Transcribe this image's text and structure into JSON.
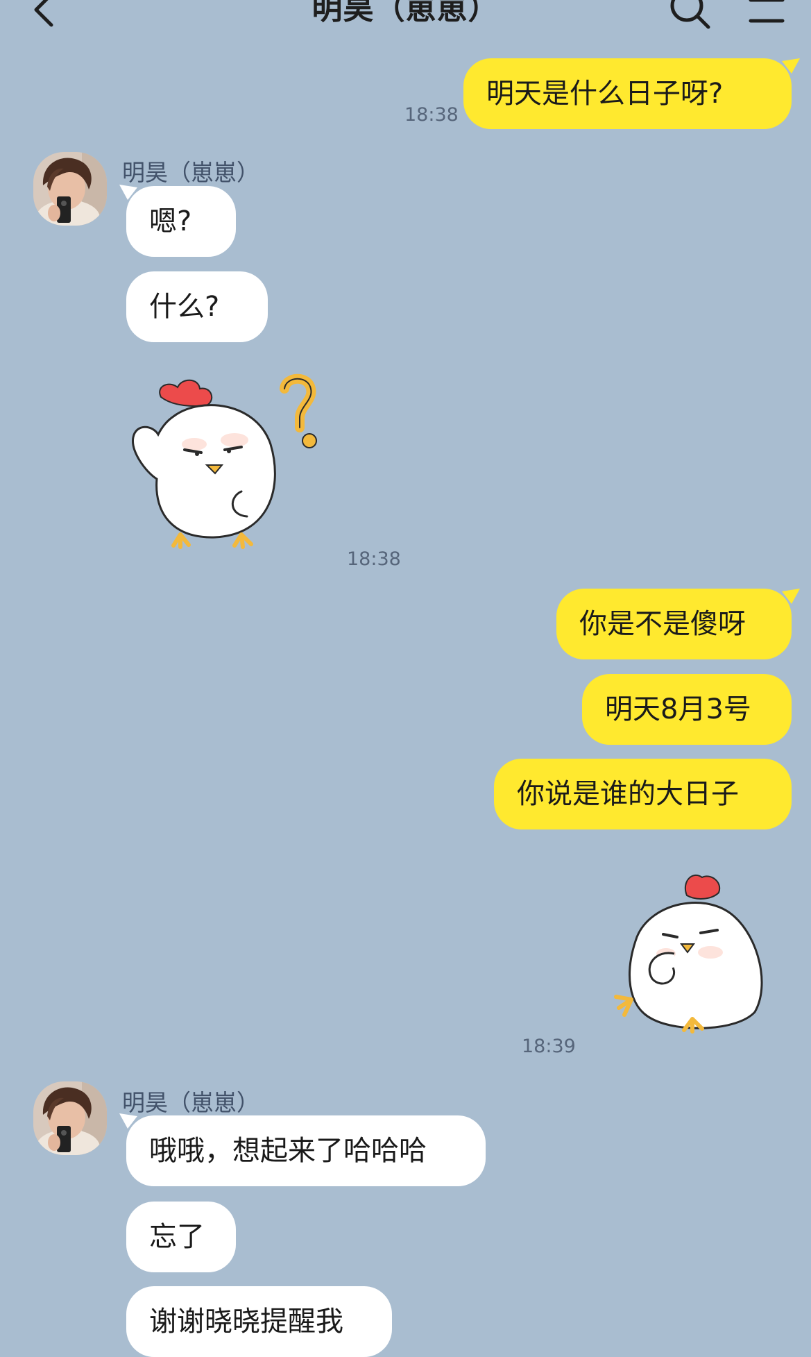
{
  "header": {
    "title": "明昊（崽崽）"
  },
  "messages": {
    "m1": {
      "text": "明天是什么日子呀?",
      "time": "18:38"
    },
    "g1": {
      "sender": "明昊（崽崽）",
      "m2": {
        "text": "嗯?"
      },
      "m3": {
        "text": "什么?"
      },
      "sticker_time": "18:38"
    },
    "m4": {
      "text": "你是不是傻呀"
    },
    "m5": {
      "text": "明天8月3号"
    },
    "m6": {
      "text": "你说是谁的大日子"
    },
    "sticker2_time": "18:39",
    "g2": {
      "sender": "明昊（崽崽）",
      "m7": {
        "text": "哦哦，想起来了哈哈哈"
      },
      "m8": {
        "text": "忘了"
      },
      "m9": {
        "text": "谢谢晓晓提醒我"
      }
    }
  },
  "colors": {
    "background": "#a9bdd0",
    "outgoing_bubble": "#ffe92f",
    "incoming_bubble": "#ffffff"
  },
  "icons": {
    "back": "chevron-left-icon",
    "search": "search-icon",
    "menu": "menu-icon",
    "sticker_1": "chicken-question-sticker",
    "sticker_2": "chicken-thinking-sticker"
  }
}
